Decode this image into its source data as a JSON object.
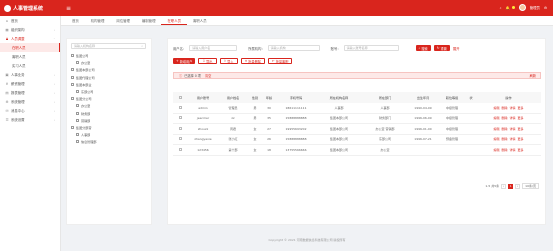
{
  "app": {
    "title": "人事管理系统",
    "user": "管理员",
    "notif": "22"
  },
  "top_links": [
    "在线文档",
    "开发者"
  ],
  "sidebar": {
    "items": [
      {
        "label": "首页",
        "icon": "home-icon",
        "open": false
      },
      {
        "label": "组织架构",
        "icon": "org-icon",
        "open": false
      },
      {
        "label": "人员调整",
        "icon": "people-icon",
        "open": true
      },
      {
        "label": "人事业务",
        "icon": "business-icon",
        "open": false
      },
      {
        "label": "薪资管理",
        "icon": "salary-icon",
        "open": false
      },
      {
        "label": "报表管理",
        "icon": "report-icon",
        "open": false
      },
      {
        "label": "系统管理",
        "icon": "system-icon",
        "open": false
      },
      {
        "label": "消息中心",
        "icon": "message-icon",
        "open": false
      },
      {
        "label": "系统设置",
        "icon": "settings-icon",
        "open": false
      }
    ],
    "sub": [
      {
        "label": "在职人员",
        "active": true
      },
      {
        "label": "离职人员",
        "active": false
      },
      {
        "label": "实习人员",
        "active": false
      }
    ]
  },
  "tabs": [
    "首页",
    "机构管理",
    "岗位管理",
    "编制管理",
    "在职人员",
    "离职人员"
  ],
  "tree": {
    "placeholder": "请输入机构名称",
    "nodes": [
      {
        "label": "集团公司",
        "depth": 0
      },
      {
        "label": "办公室",
        "depth": 1
      },
      {
        "label": "集团本部公司",
        "depth": 0
      },
      {
        "label": "集团代理公司",
        "depth": 0
      },
      {
        "label": "集团本部业",
        "depth": 0
      },
      {
        "label": "东部公司",
        "depth": 1
      },
      {
        "label": "集团分公司",
        "depth": 0
      },
      {
        "label": "办公室",
        "depth": 1
      },
      {
        "label": "财务部",
        "depth": 1
      },
      {
        "label": "营销部",
        "depth": 1
      },
      {
        "label": "集团分部营",
        "depth": 0
      },
      {
        "label": "人事部",
        "depth": 1
      },
      {
        "label": "信息管理部",
        "depth": 1
      }
    ]
  },
  "filters": {
    "name_label": "用户名：",
    "name_placeholder": "请输入用户名",
    "org_label": "所属机构：",
    "org_placeholder": "请输入机构",
    "account_label": "账号：",
    "account_placeholder": "请输入账号名称",
    "search": "搜索",
    "reset": "重置",
    "expand": "展开"
  },
  "actions": [
    "新增用户",
    "导出",
    "导入",
    "批量删除",
    "批量离职"
  ],
  "selected": {
    "text": "已选择 0 项",
    "clear": "清空",
    "refresh": "刷新"
  },
  "table": {
    "columns": [
      "",
      "用户账号",
      "用户姓名",
      "性别",
      "年龄",
      "手机号码",
      "所在机构名称",
      "所在部门",
      "出生年月",
      "职位等级",
      "状",
      "操作"
    ],
    "rows": [
      [
        "",
        "admin",
        "管理员",
        "男",
        "30",
        "18611111111",
        "人事部",
        "人事部",
        "1990-04-09",
        "中级管理",
        "",
        ""
      ],
      [
        "",
        "jeecmer",
        "zz",
        "男",
        "35",
        "15888888888",
        "集团本部公司",
        "财务部门",
        "1996-06-09",
        "中级管理",
        "",
        ""
      ],
      [
        "",
        "zhouzz",
        "周君",
        "女",
        "27",
        "19955693202",
        "集团本部公司",
        "办公室 营销部",
        "1996-01-00",
        "中级管理",
        "",
        ""
      ],
      [
        "",
        "zhangyaoie",
        "张小红",
        "女",
        "26",
        "15888888888",
        "集团本部公司",
        "东部公司",
        "1996-07-21",
        "预备管理",
        "",
        ""
      ],
      [
        "",
        "123456",
        "第十部",
        "女",
        "18",
        "13755566666",
        "集团本部公司",
        "办公室",
        "",
        "",
        "",
        ""
      ]
    ],
    "ops": [
      "编辑",
      "删除",
      "详情",
      "更多"
    ]
  },
  "pager": {
    "total": "1-5 共5条",
    "page": "1",
    "size": "10条/页"
  },
  "footer": "Copyright © 2021 河南数据信息科技有限公司 版权所有"
}
